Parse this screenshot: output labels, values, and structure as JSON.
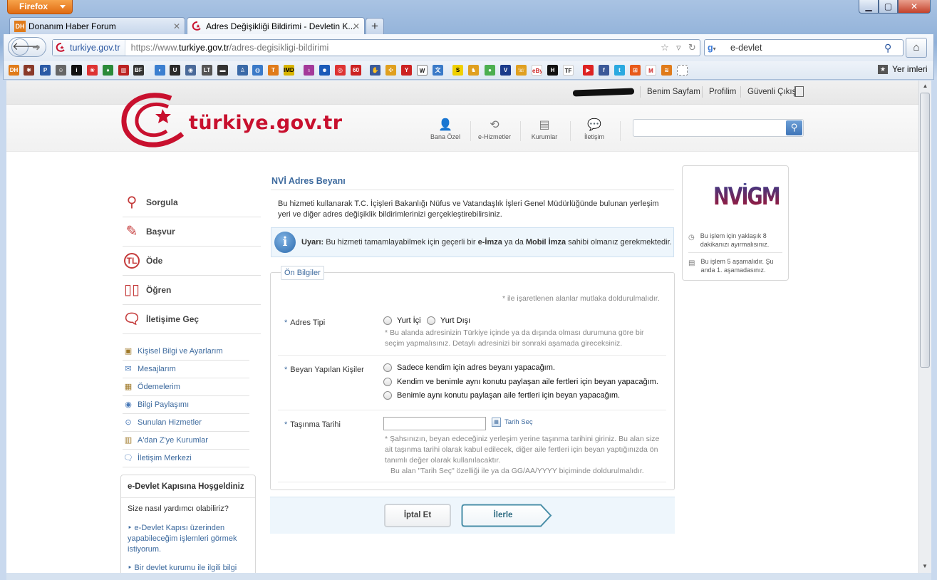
{
  "browser": {
    "app_button": "Firefox",
    "tabs": [
      {
        "label": "Donanım Haber Forum",
        "favicon": "DH"
      },
      {
        "label": "Adres Değişikliği Bildirimi - Devletin K...",
        "favicon": "turkiye-gov-icon"
      }
    ],
    "identity": "turkiye.gov.tr",
    "url_prefix": "https://www.",
    "url_domain": "turkiye.gov.tr",
    "url_path": "/adres-degisikligi-bildirimi",
    "search_value": "e-devlet",
    "bookmarks_more": "Yer imleri"
  },
  "header": {
    "user_links": [
      "Benim Sayfam",
      "Profilim",
      "Güvenli Çıkış"
    ],
    "logo_text": "türkiye.gov.tr",
    "nav": [
      {
        "label": "Bana Özel",
        "icon": "user-icon"
      },
      {
        "label": "e-Hizmetler",
        "icon": "refresh-icon"
      },
      {
        "label": "Kurumlar",
        "icon": "building-icon"
      },
      {
        "label": "İletişim",
        "icon": "chat-icon"
      }
    ]
  },
  "sidebar": {
    "main": [
      {
        "label": "Sorgula",
        "icon": "search-icon"
      },
      {
        "label": "Başvur",
        "icon": "pen-icon"
      },
      {
        "label": "Öde",
        "icon": "lira-icon"
      },
      {
        "label": "Öğren",
        "icon": "book-icon"
      },
      {
        "label": "İletişime Geç",
        "icon": "chat-icon"
      }
    ],
    "sub": [
      {
        "label": "Kişisel Bilgi ve Ayarlarım",
        "icon": "id-card-icon"
      },
      {
        "label": "Mesajlarım",
        "icon": "envelope-icon"
      },
      {
        "label": "Ödemelerim",
        "icon": "money-icon"
      },
      {
        "label": "Bilgi Paylaşımı",
        "icon": "share-icon"
      },
      {
        "label": "Sunulan Hizmetler",
        "icon": "services-icon"
      },
      {
        "label": "A'dan Z'ye Kurumlar",
        "icon": "building-icon"
      },
      {
        "label": "İletişim Merkezi",
        "icon": "chat-icon"
      }
    ],
    "welcome": {
      "title": "e-Devlet Kapısına Hoşgeldiniz",
      "question": "Size nasıl yardımcı olabiliriz?",
      "links": [
        "e-Devlet Kapısı üzerinden yapabileceğim işlemleri görmek istiyorum.",
        "Bir devlet kurumu ile ilgili bilgi almak istiyorum."
      ]
    }
  },
  "main": {
    "title": "NVİ Adres Beyanı",
    "description": "Bu hizmeti kullanarak T.C. İçişleri Bakanlığı Nüfus ve Vatandaşlık İşleri Genel Müdürlüğünde bulunan yerleşim yeri ve diğer adres değişiklik bildirimlerinizi gerçekleştirebilirsiniz.",
    "warning": {
      "prefix": "Uyarı:",
      "text1": " Bu hizmeti tamamlayabilmek için geçerli bir ",
      "bold1": "e-İmza",
      "text2": " ya da ",
      "bold2": "Mobil İmza",
      "text3": " sahibi olmanız gerekmektedir."
    },
    "legend": "Ön Bilgiler",
    "required_note": "* ile işaretlenen alanlar mutlaka doldurulmalıdır.",
    "fields": {
      "adres_tipi": {
        "label": "Adres Tipi",
        "options": [
          "Yurt İçi",
          "Yurt Dışı"
        ],
        "hint": "Bu alanda adresinizin Türkiye içinde ya da dışında olması durumuna göre bir seçim yapmalısınız. Detaylı adresinizi bir sonraki aşamada gireceksiniz."
      },
      "beyan": {
        "label": "Beyan Yapılan Kişiler",
        "options": [
          "Sadece kendim için adres beyanı yapacağım.",
          "Kendim ve benimle aynı konutu paylaşan aile fertleri için beyan yapacağım.",
          "Benimle aynı konutu paylaşan aile fertleri için beyan yapacağım."
        ]
      },
      "tasinma": {
        "label": "Taşınma Tarihi",
        "value": "",
        "date_button": "Tarih Seç",
        "hint": "Şahsınızın, beyan edeceğiniz yerleşim yerine taşınma tarihini giriniz. Bu alan size ait taşınma tarihi olarak kabul edilecek, diğer aile fertleri için beyan yaptığınızda ön tanımlı değer olarak kullanılacaktır.",
        "hint2": "Bu alan \"Tarih Seç\" özelliği ile ya da GG/AA/YYYY biçiminde doldurulmalıdır."
      }
    },
    "buttons": {
      "cancel": "İptal Et",
      "next": "İlerle"
    }
  },
  "rightbox": {
    "logo": "NVİGM",
    "info": [
      {
        "text": "Bu işlem için yaklaşık 8 dakikanızı ayırmalısınız.",
        "icon": "clock-icon"
      },
      {
        "text": "Bu işlem 5 aşamalıdır. Şu anda 1. aşamadasınız.",
        "icon": "steps-icon"
      }
    ]
  }
}
